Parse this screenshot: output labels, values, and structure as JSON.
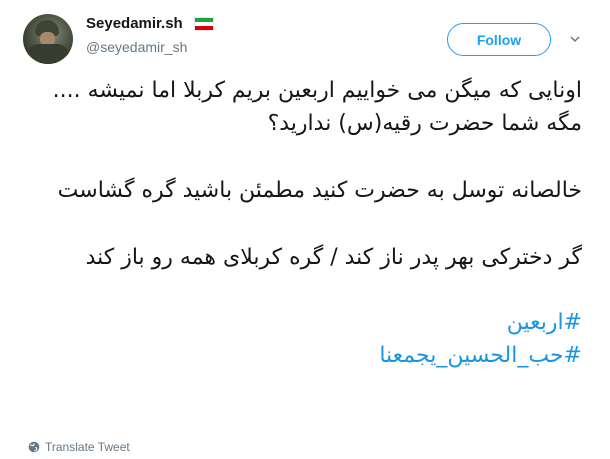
{
  "user": {
    "display_name": "Seyedamir.sh",
    "handle": "@seyedamir_sh",
    "flag_colors": [
      "#239f40",
      "#ffffff",
      "#da0000"
    ]
  },
  "actions": {
    "follow_label": "Follow"
  },
  "tweet": {
    "paragraphs": [
      "اونایی که میگن می خواییم اربعین بریم کربلا اما نمیشه .... مگه شما حضرت رقیه(س)  ندارید؟",
      "خالصانه توسل به حضرت کنید مطمئن باشید گره گشاست",
      "گر دخترکی بهر پدر ناز کند / گره کربلای همه رو باز کند"
    ],
    "hashtags": [
      "#اربعین",
      "#حب_الحسین_یجمعنا"
    ]
  },
  "footer": {
    "translate_label": "Translate Tweet"
  },
  "colors": {
    "accent": "#1da1f2",
    "link": "#1b95e0",
    "muted": "#657786",
    "text": "#14171a"
  }
}
